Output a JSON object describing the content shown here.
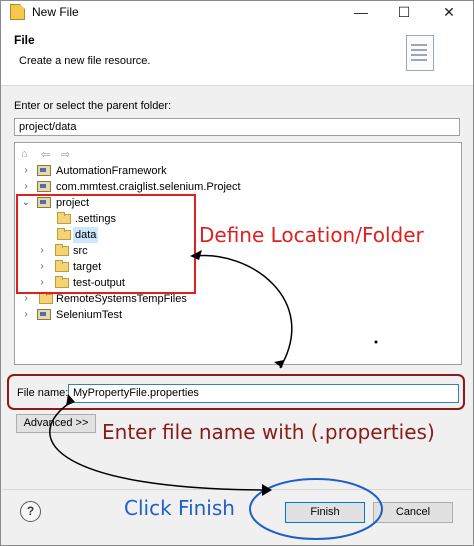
{
  "window": {
    "title": "New File",
    "minimize": "—",
    "maximize": "☐",
    "close": "✕"
  },
  "header": {
    "title": "File",
    "description": "Create a new file resource."
  },
  "parent": {
    "label": "Enter or select the parent folder:",
    "value": "project/data"
  },
  "tree": {
    "items": [
      {
        "label": "AutomationFramework"
      },
      {
        "label": "com.mmtest.craiglist.selenium.Project"
      },
      {
        "label": "project"
      },
      {
        "label": ".settings"
      },
      {
        "label": "data"
      },
      {
        "label": "src"
      },
      {
        "label": "target"
      },
      {
        "label": "test-output"
      },
      {
        "label": "RemoteSystemsTempFiles"
      },
      {
        "label": "SeleniumTest"
      }
    ]
  },
  "filename": {
    "label": "File name:",
    "value": "MyPropertyFile.properties"
  },
  "buttons": {
    "advanced": "Advanced >>",
    "help": "?",
    "finish": "Finish",
    "cancel": "Cancel"
  },
  "annotations": {
    "location": "Define Location/Folder",
    "filename": "Enter file name with (.properties)",
    "finish": "Click Finish",
    "colors": {
      "red": "#e02020",
      "darkred": "#8b1a1a",
      "blue": "#1f5fc8",
      "highlight": "#cce8ff"
    }
  }
}
